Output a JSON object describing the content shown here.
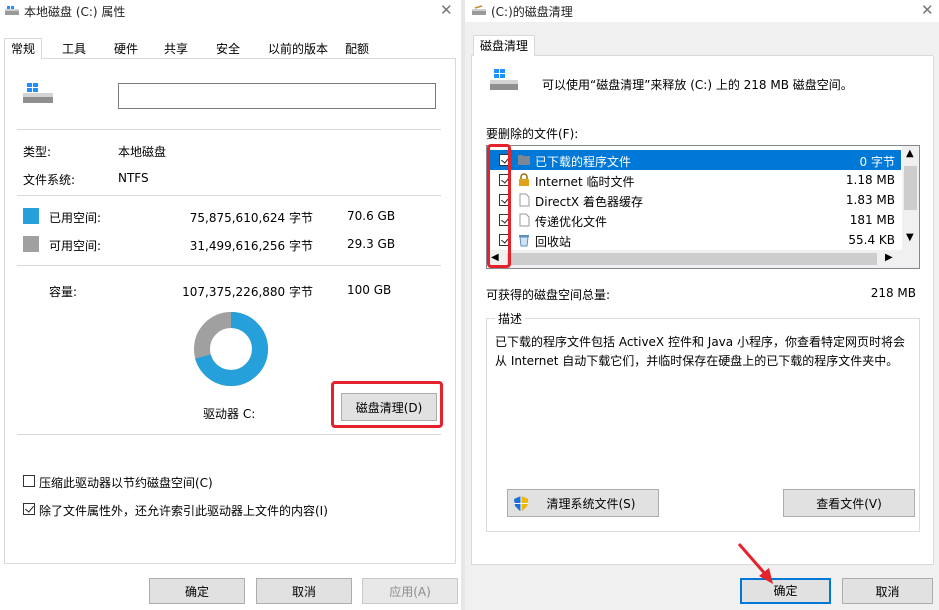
{
  "left": {
    "title": "本地磁盘 (C:) 属性",
    "tabs": [
      "常规",
      "工具",
      "硬件",
      "共享",
      "安全",
      "以前的版本",
      "配额"
    ],
    "active_tab": "常规",
    "volume_label_value": "",
    "type_label": "类型:",
    "type_value": "本地磁盘",
    "fs_label": "文件系统:",
    "fs_value": "NTFS",
    "used_label": "已用空间:",
    "used_bytes": "75,875,610,624 字节",
    "used_size": "70.6 GB",
    "free_label": "可用空间:",
    "free_bytes": "31,499,616,256 字节",
    "free_size": "29.3 GB",
    "capacity_label": "容量:",
    "capacity_bytes": "107,375,226,880 字节",
    "capacity_size": "100 GB",
    "drive_label": "驱动器 C:",
    "cleanup_button": "磁盘清理(D)",
    "compress_label": "压缩此驱动器以节约磁盘空间(C)",
    "compress_checked": false,
    "index_label": "除了文件属性外，还允许索引此驱动器上文件的内容(I)",
    "index_checked": true,
    "ok": "确定",
    "cancel": "取消",
    "apply": "应用(A)",
    "colors": {
      "used": "#26a0da",
      "free": "#a0a0a0"
    },
    "used_fraction": 0.7067
  },
  "right": {
    "title": "(C:)的磁盘清理",
    "tab": "磁盘清理",
    "intro": "可以使用“磁盘清理”来释放 (C:) 上的 218 MB 磁盘空间。",
    "files_label": "要删除的文件(F):",
    "files": [
      {
        "name": "已下载的程序文件",
        "size": "0 字节",
        "checked": true,
        "selected": true,
        "icon": "folder-icon"
      },
      {
        "name": "Internet 临时文件",
        "size": "1.18 MB",
        "checked": true,
        "selected": false,
        "icon": "lock-icon"
      },
      {
        "name": "DirectX 着色器缓存",
        "size": "1.83 MB",
        "checked": true,
        "selected": false,
        "icon": "file-icon"
      },
      {
        "name": "传递优化文件",
        "size": "181 MB",
        "checked": true,
        "selected": false,
        "icon": "file-icon"
      },
      {
        "name": "回收站",
        "size": "55.4 KB",
        "checked": true,
        "selected": false,
        "icon": "recycle-bin-icon"
      }
    ],
    "total_label": "可获得的磁盘空间总量:",
    "total_value": "218 MB",
    "desc_title": "描述",
    "desc_text": "已下载的程序文件包括 ActiveX 控件和 Java 小程序，你查看特定网页时将会从 Internet 自动下载它们，并临时保存在硬盘上的已下载的程序文件夹中。",
    "clean_system_button": "清理系统文件(S)",
    "view_files_button": "查看文件(V)",
    "ok": "确定",
    "cancel": "取消"
  }
}
